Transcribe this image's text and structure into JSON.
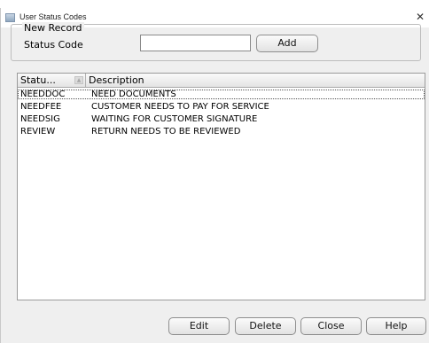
{
  "window": {
    "title": "User Status Codes",
    "close_glyph": "✕"
  },
  "new_record": {
    "legend": "New Record",
    "status_code_label": "Status Code",
    "status_code_value": "",
    "add_label": "Add"
  },
  "grid": {
    "columns": [
      "Statu...",
      "Description"
    ],
    "sort_indicator": "ascending",
    "rows": [
      {
        "code": "NEEDDOC",
        "description": "NEED DOCUMENTS"
      },
      {
        "code": "NEEDFEE",
        "description": "CUSTOMER NEEDS TO PAY FOR SERVICE"
      },
      {
        "code": "NEEDSIG",
        "description": "WAITING FOR CUSTOMER SIGNATURE"
      },
      {
        "code": "REVIEW",
        "description": "RETURN NEEDS TO BE REVIEWED"
      }
    ]
  },
  "footer": {
    "edit_label": "Edit",
    "delete_label": "Delete",
    "close_label": "Close",
    "help_label": "Help"
  }
}
